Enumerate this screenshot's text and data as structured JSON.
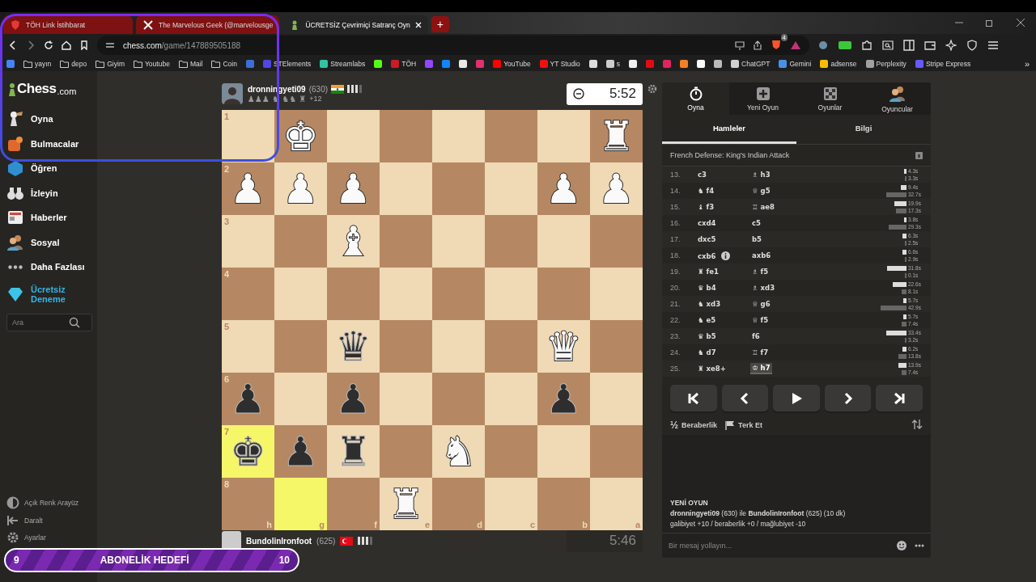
{
  "browser": {
    "tabs": [
      {
        "title": "TÖH Link İstihbarat",
        "selected": false,
        "color": "#7e1111"
      },
      {
        "title": "The Marvelous Geek (@marvelousge",
        "selected": false,
        "color": "#7e1111"
      },
      {
        "title": "ÜCRETSİZ Çevrimiçi Satranç Oyn",
        "selected": true,
        "color": "#252525"
      }
    ],
    "new_tab": "+",
    "address": {
      "domain": "chess.com",
      "path": "/game/147889505188"
    },
    "extension_badge": "4",
    "bookmarks": [
      {
        "kind": "site",
        "color": "#4285f4"
      },
      {
        "kind": "folder",
        "label": "yayın"
      },
      {
        "kind": "folder",
        "label": "depo"
      },
      {
        "kind": "folder",
        "label": "Giyim"
      },
      {
        "kind": "folder",
        "label": "Youtube"
      },
      {
        "kind": "folder",
        "label": "Mail"
      },
      {
        "kind": "folder",
        "label": "Coin"
      },
      {
        "kind": "site",
        "color": "#3b6fd8"
      },
      {
        "kind": "site",
        "color": "#5046e5",
        "label": "STElements"
      },
      {
        "kind": "site",
        "color": "#31c3a2",
        "label": "Streamlabs"
      },
      {
        "kind": "site",
        "color": "#53fc18"
      },
      {
        "kind": "site",
        "color": "#c81d25",
        "label": "TÖH"
      },
      {
        "kind": "site",
        "color": "#9146ff"
      },
      {
        "kind": "site",
        "color": "#1185fe"
      },
      {
        "kind": "site",
        "color": "#e8e8e8"
      },
      {
        "kind": "site",
        "color": "#e1306c"
      },
      {
        "kind": "site",
        "color": "#ff0000",
        "label": "YouTube"
      },
      {
        "kind": "site",
        "color": "#ee1111",
        "label": "YT Studio"
      },
      {
        "kind": "site",
        "color": "#dddddd"
      },
      {
        "kind": "site",
        "color": "#cccccc",
        "label": "s"
      },
      {
        "kind": "site",
        "color": "#f0f0f0"
      },
      {
        "kind": "site",
        "color": "#e50914"
      },
      {
        "kind": "site",
        "color": "#e0245e"
      },
      {
        "kind": "site",
        "color": "#f48024"
      },
      {
        "kind": "site",
        "color": "#fafafa"
      },
      {
        "kind": "site",
        "color": "#bbbbbb"
      },
      {
        "kind": "site",
        "color": "#d0d0d0",
        "label": "ChatGPT"
      },
      {
        "kind": "site",
        "color": "#4a90e2",
        "label": "Gemini"
      },
      {
        "kind": "site",
        "color": "#fbbc04",
        "label": "adsense"
      },
      {
        "kind": "site",
        "color": "#a0a0a0",
        "label": "Perplexity"
      },
      {
        "kind": "site",
        "color": "#635bff",
        "label": "Stripe Express"
      }
    ],
    "bookmarks_more": "»"
  },
  "sidebar": {
    "logo": {
      "text": "Chess",
      "suffix": ".com"
    },
    "items": [
      {
        "label": "Oyna",
        "promo": false
      },
      {
        "label": "Bulmacalar",
        "promo": false
      },
      {
        "label": "Öğren",
        "promo": false
      },
      {
        "label": "İzleyin",
        "promo": false
      },
      {
        "label": "Haberler",
        "promo": false
      },
      {
        "label": "Sosyal",
        "promo": false
      },
      {
        "label": "Daha Fazlası",
        "promo": false
      },
      {
        "label": "Ücretsiz Deneme",
        "promo": true
      }
    ],
    "search": {
      "placeholder": "Ara"
    },
    "footer": [
      {
        "label": "Açık Renk Arayüz"
      },
      {
        "label": "Daralt"
      },
      {
        "label": "Ayarlar"
      }
    ]
  },
  "top_player": {
    "name": "dronningyeti09",
    "rating": "(630)",
    "captured": "♟♟♟ ♞ ♞♞ ♜",
    "advantage": "+12",
    "clock": "5:52",
    "clock_active": true
  },
  "board": {
    "files": [
      "h",
      "g",
      "f",
      "e",
      "d",
      "c",
      "b",
      "a"
    ],
    "ranks": [
      {
        "label": "1",
        "squares": [
          {
            "highlighted": false
          },
          {
            "glyph": "♚",
            "kind": "white",
            "highlighted": false
          },
          {
            "highlighted": false
          },
          {
            "highlighted": false
          },
          {
            "highlighted": false
          },
          {
            "highlighted": false
          },
          {
            "highlighted": false
          },
          {
            "glyph": "♜",
            "kind": "white",
            "highlighted": false
          }
        ]
      },
      {
        "label": "2",
        "squares": [
          {
            "glyph": "♟",
            "kind": "white",
            "highlighted": false
          },
          {
            "glyph": "♟",
            "kind": "white",
            "highlighted": false
          },
          {
            "glyph": "♟",
            "kind": "white",
            "highlighted": false
          },
          {
            "highlighted": false
          },
          {
            "highlighted": false
          },
          {
            "highlighted": false
          },
          {
            "glyph": "♟",
            "kind": "white",
            "highlighted": false
          },
          {
            "glyph": "♟",
            "kind": "white",
            "highlighted": false
          }
        ]
      },
      {
        "label": "3",
        "squares": [
          {
            "highlighted": false
          },
          {
            "highlighted": false
          },
          {
            "glyph": "♝",
            "kind": "white",
            "highlighted": false
          },
          {
            "highlighted": false
          },
          {
            "highlighted": false
          },
          {
            "highlighted": false
          },
          {
            "highlighted": false
          },
          {
            "highlighted": false
          }
        ]
      },
      {
        "label": "4",
        "squares": [
          {
            "highlighted": false
          },
          {
            "highlighted": false
          },
          {
            "highlighted": false
          },
          {
            "highlighted": false
          },
          {
            "highlighted": false
          },
          {
            "highlighted": false
          },
          {
            "highlighted": false
          },
          {
            "highlighted": false
          }
        ]
      },
      {
        "label": "5",
        "squares": [
          {
            "highlighted": false
          },
          {
            "highlighted": false
          },
          {
            "glyph": "♛",
            "kind": "black",
            "highlighted": false
          },
          {
            "highlighted": false
          },
          {
            "highlighted": false
          },
          {
            "highlighted": false
          },
          {
            "glyph": "♛",
            "kind": "white",
            "highlighted": false
          },
          {
            "highlighted": false
          }
        ]
      },
      {
        "label": "6",
        "squares": [
          {
            "glyph": "♟",
            "kind": "black",
            "highlighted": false
          },
          {
            "highlighted": false
          },
          {
            "glyph": "♟",
            "kind": "black",
            "highlighted": false
          },
          {
            "highlighted": false
          },
          {
            "highlighted": false
          },
          {
            "highlighted": false
          },
          {
            "glyph": "♟",
            "kind": "black",
            "highlighted": false
          },
          {
            "highlighted": false
          }
        ]
      },
      {
        "label": "7",
        "squares": [
          {
            "glyph": "♚",
            "kind": "black",
            "highlighted": true
          },
          {
            "glyph": "♟",
            "kind": "black",
            "highlighted": false
          },
          {
            "glyph": "♜",
            "kind": "black",
            "highlighted": false
          },
          {
            "highlighted": false
          },
          {
            "glyph": "♞",
            "kind": "white",
            "highlighted": false
          },
          {
            "highlighted": false
          },
          {
            "highlighted": false
          },
          {
            "highlighted": false
          }
        ]
      },
      {
        "label": "8",
        "squares": [
          {
            "highlighted": false
          },
          {
            "highlighted": true
          },
          {
            "highlighted": false
          },
          {
            "glyph": "♜",
            "kind": "white",
            "highlighted": false
          },
          {
            "highlighted": false
          },
          {
            "highlighted": false
          },
          {
            "highlighted": false
          },
          {
            "highlighted": false
          }
        ]
      }
    ]
  },
  "bottom_player": {
    "name": "BundolinIronfoot",
    "rating": "(625)",
    "clock": "5:46",
    "clock_active": false
  },
  "panel": {
    "nav_tabs": [
      {
        "label": "Oyna",
        "selected": true
      },
      {
        "label": "Yeni Oyun",
        "selected": false
      },
      {
        "label": "Oyunlar",
        "selected": false
      },
      {
        "label": "Oyuncular",
        "selected": false
      }
    ],
    "sub_tabs": [
      {
        "label": "Hamleler",
        "selected": true
      },
      {
        "label": "Bilgi",
        "selected": false
      }
    ],
    "opening": "French Defense: King's Indian Attack",
    "moves": [
      {
        "number": "13.",
        "white": {
          "san": "c3",
          "note": false,
          "selected": false
        },
        "black": {
          "san": "♗ h3",
          "note": false,
          "selected": false
        },
        "white_time": "4.3s",
        "black_time": "3.3s"
      },
      {
        "number": "14.",
        "white": {
          "san": "♞ f4",
          "note": false,
          "selected": false
        },
        "black": {
          "san": "♕ g5",
          "note": false,
          "selected": false
        },
        "white_time": "9.4s",
        "black_time": "32.7s"
      },
      {
        "number": "15.",
        "white": {
          "san": "♝ f3",
          "note": false,
          "selected": false
        },
        "black": {
          "san": "♖ ae8",
          "note": false,
          "selected": false
        },
        "white_time": "19.9s",
        "black_time": "17.3s"
      },
      {
        "number": "16.",
        "white": {
          "san": "cxd4",
          "note": false,
          "selected": false
        },
        "black": {
          "san": "c5",
          "note": false,
          "selected": false
        },
        "white_time": "3.8s",
        "black_time": "29.3s"
      },
      {
        "number": "17.",
        "white": {
          "san": "dxc5",
          "note": false,
          "selected": false
        },
        "black": {
          "san": "b5",
          "note": false,
          "selected": false
        },
        "white_time": "6.3s",
        "black_time": "2.5s"
      },
      {
        "number": "18.",
        "white": {
          "san": "cxb6",
          "note": true,
          "selected": false
        },
        "black": {
          "san": "axb6",
          "note": false,
          "selected": false
        },
        "white_time": "6.6s",
        "black_time": "2.9s"
      },
      {
        "number": "19.",
        "white": {
          "san": "♜ fe1",
          "note": false,
          "selected": false
        },
        "black": {
          "san": "♗ f5",
          "note": false,
          "selected": false
        },
        "white_time": "31.8s",
        "black_time": "0.1s"
      },
      {
        "number": "20.",
        "white": {
          "san": "♛ b4",
          "note": false,
          "selected": false
        },
        "black": {
          "san": "♗ xd3",
          "note": false,
          "selected": false
        },
        "white_time": "22.6s",
        "black_time": "8.1s"
      },
      {
        "number": "21.",
        "white": {
          "san": "♞ xd3",
          "note": false,
          "selected": false
        },
        "black": {
          "san": "♕ g6",
          "note": false,
          "selected": false
        },
        "white_time": "5.7s",
        "black_time": "42.9s"
      },
      {
        "number": "22.",
        "white": {
          "san": "♞ e5",
          "note": false,
          "selected": false
        },
        "black": {
          "san": "♕ f5",
          "note": false,
          "selected": false
        },
        "white_time": "5.7s",
        "black_time": "7.4s"
      },
      {
        "number": "23.",
        "white": {
          "san": "♛ b5",
          "note": false,
          "selected": false
        },
        "black": {
          "san": "f6",
          "note": false,
          "selected": false
        },
        "white_time": "33.4s",
        "black_time": "3.2s"
      },
      {
        "number": "24.",
        "white": {
          "san": "♞ d7",
          "note": false,
          "selected": false
        },
        "black": {
          "san": "♖ f7",
          "note": false,
          "selected": false
        },
        "white_time": "6.2s",
        "black_time": "13.8s"
      },
      {
        "number": "25.",
        "white": {
          "san": "♜ xe8+",
          "note": false,
          "selected": false
        },
        "black": {
          "san": "♔ h7",
          "note": false,
          "selected": true
        },
        "white_time": "13.9s",
        "black_time": "7.4s"
      }
    ],
    "controls": [
      {
        "kind": "first"
      },
      {
        "kind": "prev"
      },
      {
        "kind": "play"
      },
      {
        "kind": "next"
      },
      {
        "kind": "last"
      }
    ],
    "draw": {
      "icon": "½",
      "label": "Beraberlik"
    },
    "resign": {
      "label": "Terk Et"
    },
    "chat": {
      "heading": "YENİ OYUN",
      "lines": [
        "**dronningyeti09** (630) ile **BundolinIronfoot** (625) (10 dk)",
        "galibiyet +10 / beraberlik +0 / mağlubiyet -10"
      ],
      "placeholder": "Bir mesaj yollayın..."
    }
  },
  "overlay": {
    "goal": {
      "current": "9",
      "title": "ABONELİK HEDEFİ",
      "target": "10"
    }
  }
}
